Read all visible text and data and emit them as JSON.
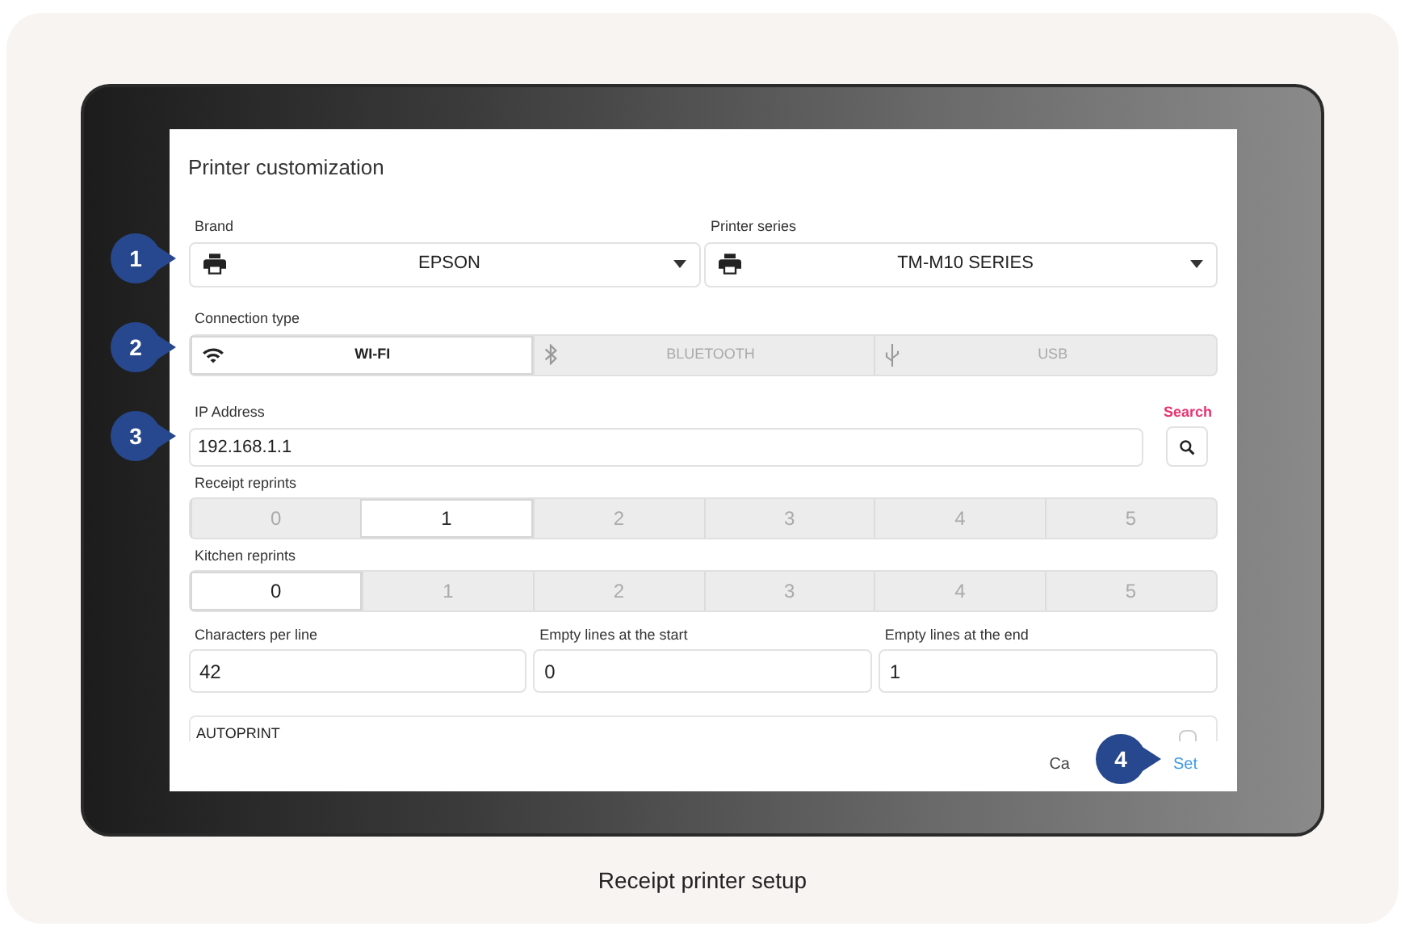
{
  "dialog": {
    "title": "Printer customization",
    "brand": {
      "label": "Brand",
      "value": "EPSON"
    },
    "printer_series": {
      "label": "Printer series",
      "value": "TM-M10 SERIES"
    },
    "connection_type": {
      "label": "Connection type",
      "options": [
        {
          "label": "WI-FI",
          "kind": "wifi",
          "selected": true
        },
        {
          "label": "BLUETOOTH",
          "kind": "bluetooth",
          "selected": false
        },
        {
          "label": "USB",
          "kind": "usb",
          "selected": false
        }
      ]
    },
    "ip_address": {
      "label": "IP Address",
      "value": "192.168.1.1",
      "search_label": "Search"
    },
    "receipt_reprints": {
      "label": "Receipt reprints",
      "options": [
        {
          "label": "0",
          "selected": false
        },
        {
          "label": "1",
          "selected": true
        },
        {
          "label": "2",
          "selected": false
        },
        {
          "label": "3",
          "selected": false
        },
        {
          "label": "4",
          "selected": false
        },
        {
          "label": "5",
          "selected": false
        }
      ]
    },
    "kitchen_reprints": {
      "label": "Kitchen reprints",
      "options": [
        {
          "label": "0",
          "selected": true
        },
        {
          "label": "1",
          "selected": false
        },
        {
          "label": "2",
          "selected": false
        },
        {
          "label": "3",
          "selected": false
        },
        {
          "label": "4",
          "selected": false
        },
        {
          "label": "5",
          "selected": false
        }
      ]
    },
    "fields": [
      {
        "label": "Characters per line",
        "value": "42"
      },
      {
        "label": "Empty lines at the start",
        "value": "0"
      },
      {
        "label": "Empty lines at the end",
        "value": "1"
      }
    ],
    "autoprint": {
      "label": "AUTOPRINT",
      "checked": false
    },
    "buttons": [
      {
        "label": "Ca",
        "kind": "cancel"
      },
      {
        "label": "Set",
        "kind": "primary"
      }
    ]
  },
  "callouts": [
    "1",
    "2",
    "3",
    "4"
  ],
  "caption": "Receipt printer setup"
}
